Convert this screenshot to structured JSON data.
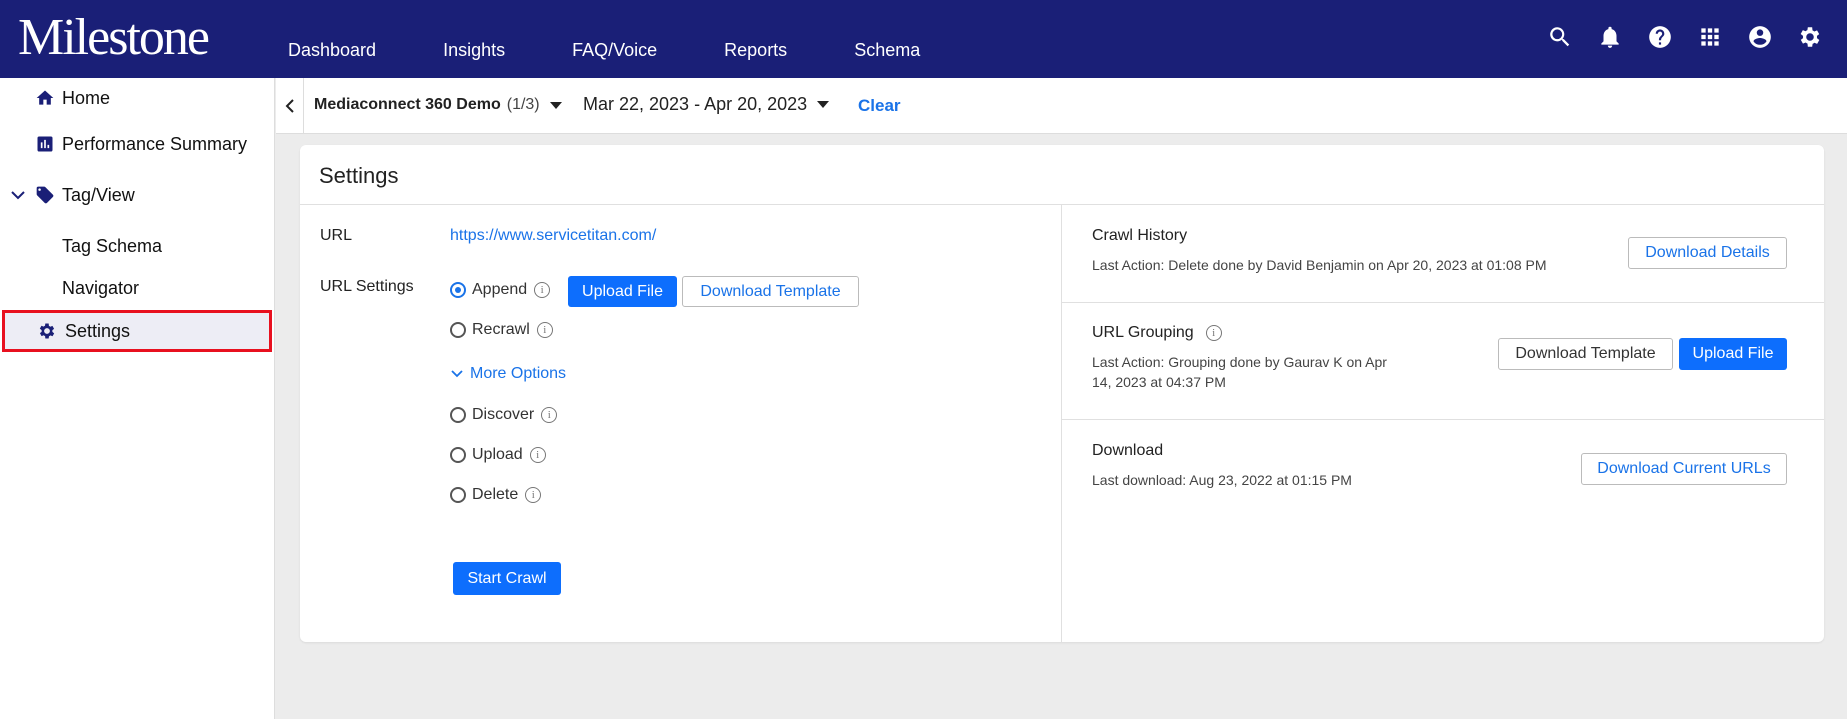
{
  "app": {
    "logo": "Milestone",
    "nav": [
      "Dashboard",
      "Insights",
      "FAQ/Voice",
      "Reports",
      "Schema"
    ]
  },
  "sidebar": {
    "home": "Home",
    "performance": "Performance Summary",
    "tagview": "Tag/View",
    "tagschema": "Tag Schema",
    "navigator": "Navigator",
    "settings": "Settings"
  },
  "filter": {
    "account": "Mediaconnect 360 Demo",
    "account_count": "(1/3)",
    "date_range": "Mar 22, 2023 - Apr 20, 2023",
    "clear": "Clear"
  },
  "settings": {
    "title": "Settings",
    "url_label": "URL",
    "url_value": "https://www.servicetitan.com/",
    "url_settings_label": "URL Settings",
    "options": {
      "append": "Append",
      "recrawl": "Recrawl",
      "discover": "Discover",
      "upload": "Upload",
      "delete": "Delete"
    },
    "selected_option": "Append",
    "upload_file": "Upload File",
    "download_template": "Download Template",
    "more_options": "More Options",
    "start_crawl": "Start Crawl"
  },
  "crawl_history": {
    "title": "Crawl History",
    "subtitle": "Last Action: Delete done by David Benjamin on Apr 20, 2023 at 01:08 PM",
    "button": "Download Details"
  },
  "url_grouping": {
    "title": "URL Grouping",
    "subtitle_line1": "Last Action: Grouping done by Gaurav K on Apr",
    "subtitle_line2": "14, 2023 at 04:37 PM",
    "download_template": "Download Template",
    "upload_file": "Upload File"
  },
  "download": {
    "title": "Download",
    "subtitle": "Last download: Aug 23, 2022 at 01:15 PM",
    "button": "Download Current URLs"
  },
  "colors": {
    "header": "#1a1f77",
    "accent": "#1a73e8",
    "primary_button": "#0d6efd",
    "highlight_border": "#e8101f"
  }
}
